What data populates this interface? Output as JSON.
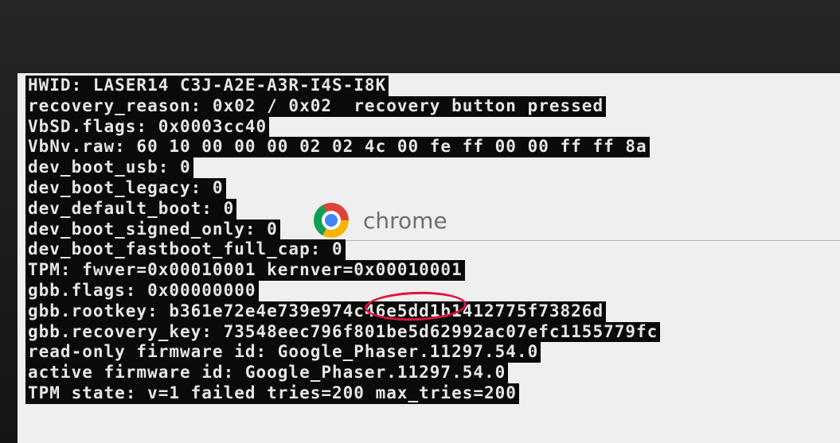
{
  "logo": {
    "text": "chrome",
    "icon": "chrome-icon"
  },
  "lines": [
    "HWID: LASER14 C3J-A2E-A3R-I4S-I8K",
    "recovery_reason: 0x02 / 0x02  recovery button pressed",
    "VbSD.flags: 0x0003cc40",
    "VbNv.raw: 60 10 00 00 00 02 02 4c 00 fe ff 00 00 ff ff 8a",
    "dev_boot_usb: 0",
    "dev_boot_legacy: 0",
    "dev_default_boot: 0",
    "dev_boot_signed_only: 0",
    "dev_boot_fastboot_full_cap: 0",
    "TPM: fwver=0x00010001 kernver=0x00010001",
    "gbb.flags: 0x00000000",
    "gbb.rootkey: b361e72e4e739e974c46e5dd1b1412775f73826d",
    "gbb.recovery_key: 73548eec796f801be5d62992ac07efc1155779fc",
    "read-only firmware id: Google_Phaser.11297.54.0",
    "active firmware id: Google_Phaser.11297.54.0",
    "TPM state: v=1 failed tries=200 max_tries=200"
  ],
  "annotation": {
    "color": "#e0153a"
  }
}
